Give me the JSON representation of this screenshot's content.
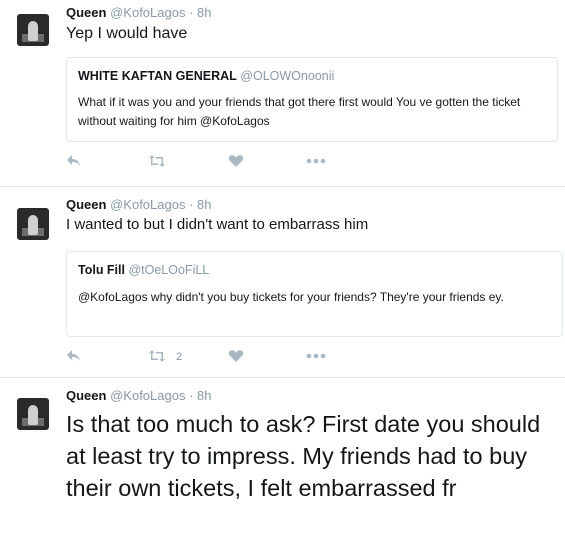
{
  "tweets": [
    {
      "name": "Queen",
      "handle": "@KofoLagos",
      "dot": "·",
      "time": "8h",
      "text": "Yep I would have",
      "quote": {
        "name": "WHITE KAFTAN GENERAL",
        "handle": "@OLOWOnoonii",
        "text": "What if it was you and your friends that got there first would You ve gotten the ticket without waiting for him @KofoLagos"
      },
      "actions": {
        "retweet_count": ""
      }
    },
    {
      "name": "Queen",
      "handle": "@KofoLagos",
      "dot": "·",
      "time": "8h",
      "text": "I wanted to but I didn't want to embarrass him",
      "quote": {
        "name": "Tolu Fill",
        "handle": "@tOeLOoFiLL",
        "text": "@KofoLagos why didn't you buy tickets for your friends? They're your friends ey."
      },
      "actions": {
        "retweet_count": "2"
      }
    },
    {
      "name": "Queen",
      "handle": "@KofoLagos",
      "dot": "·",
      "time": "8h",
      "text": "Is that too much to ask? First date you should at least try to impress. My friends had to buy their own tickets, I felt embarrassed fr"
    }
  ],
  "icons": {
    "reply": "reply-icon",
    "retweet": "retweet-icon",
    "like": "heart-icon",
    "more": "more-icon"
  },
  "colors": {
    "text": "#14171a",
    "muted": "#8899a6",
    "icon": "#aab8c2",
    "border": "#e1e8ed"
  }
}
